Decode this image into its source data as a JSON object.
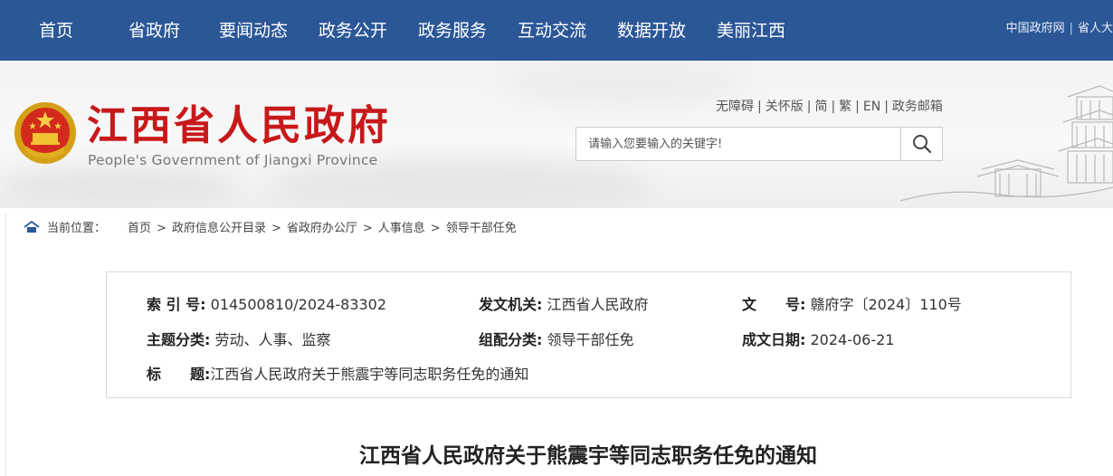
{
  "nav": {
    "items": [
      "首页",
      "省政府",
      "要闻动态",
      "政务公开",
      "政务服务",
      "互动交流",
      "数据开放",
      "美丽江西"
    ],
    "quick_links": [
      "中国政府网",
      "省人大"
    ]
  },
  "header": {
    "title": "江西省人民政府",
    "subtitle": "People's Government of Jiangxi Province",
    "util_links": [
      "无障碍",
      "关怀版",
      "简",
      "繁",
      "EN",
      "政务邮箱"
    ],
    "search_placeholder": "请输入您要输入的关键字!"
  },
  "breadcrumb": {
    "label": "当前位置：",
    "items": [
      "首页",
      "政府信息公开目录",
      "省政府办公厅",
      "人事信息",
      "领导干部任免"
    ]
  },
  "info": {
    "index_label": "索 引 号:",
    "index_value": "014500810/2024-83302",
    "issuer_label": "发文机关:",
    "issuer_value": "江西省人民政府",
    "docno_label": "文　　号:",
    "docno_value": "赣府字〔2024〕110号",
    "topic_label": "主题分类:",
    "topic_value": "劳动、人事、监察",
    "category_label": "组配分类:",
    "category_value": "领导干部任免",
    "date_label": "成文日期:",
    "date_value": "2024-06-21",
    "title_label": "标　　题:",
    "title_value": "江西省人民政府关于熊震宇等同志职务任免的通知"
  },
  "doc": {
    "title": "江西省人民政府关于熊震宇等同志职务任免的通知"
  },
  "colors": {
    "nav_bg": "#2b5797",
    "brand_red": "#c8191a"
  }
}
